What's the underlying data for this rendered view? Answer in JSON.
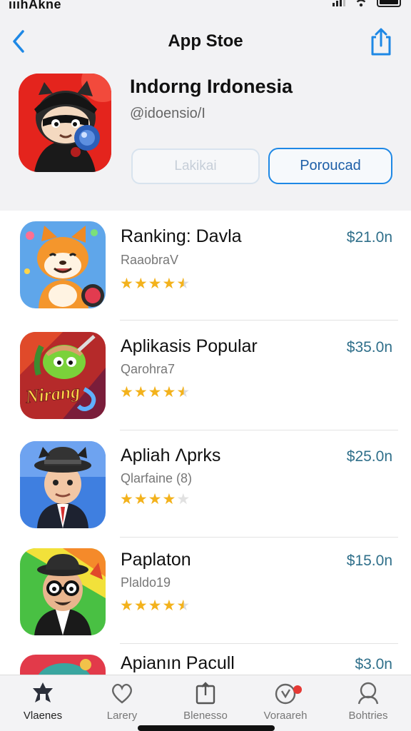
{
  "status_bar": {
    "carrier": "ıııhAkne"
  },
  "nav": {
    "title": "App Stoe"
  },
  "developer": {
    "name": "Indorng  Irdonesia",
    "handle": "@idoensio/I",
    "button_secondary": "Lakikai",
    "button_primary": "Poroucad"
  },
  "apps": [
    {
      "name": "Ranking: Davla",
      "subtitle": "RaaobraV",
      "price": "$21.0n",
      "rating": 4.5
    },
    {
      "name": "Aplikasis Popular",
      "subtitle": "Qarohra7",
      "price": "$35.0n",
      "rating": 4.5
    },
    {
      "name": "Apliah Λprks",
      "subtitle": "Qlarfaine (8)",
      "price": "$25.0n",
      "rating": 4
    },
    {
      "name": "Paplaton",
      "subtitle": "Plaldo19",
      "price": "$15.0n",
      "rating": 4.5
    },
    {
      "name": "Apianın Pacull",
      "subtitle": "",
      "price": "$3.0n",
      "rating": 0
    }
  ],
  "icon_art_text": "Nirang",
  "tabs": [
    {
      "label": "Vlaenes",
      "icon": "home-icon"
    },
    {
      "label": "Larery",
      "icon": "heart-icon"
    },
    {
      "label": "Blenesso",
      "icon": "share-box-icon"
    },
    {
      "label": "Voraareh",
      "icon": "clock-icon"
    },
    {
      "label": "Bohtries",
      "icon": "person-icon"
    }
  ],
  "colors": {
    "accent": "#1e88e5",
    "star": "#f3b21c",
    "price": "#2f6f8a",
    "badge": "#e53935"
  }
}
